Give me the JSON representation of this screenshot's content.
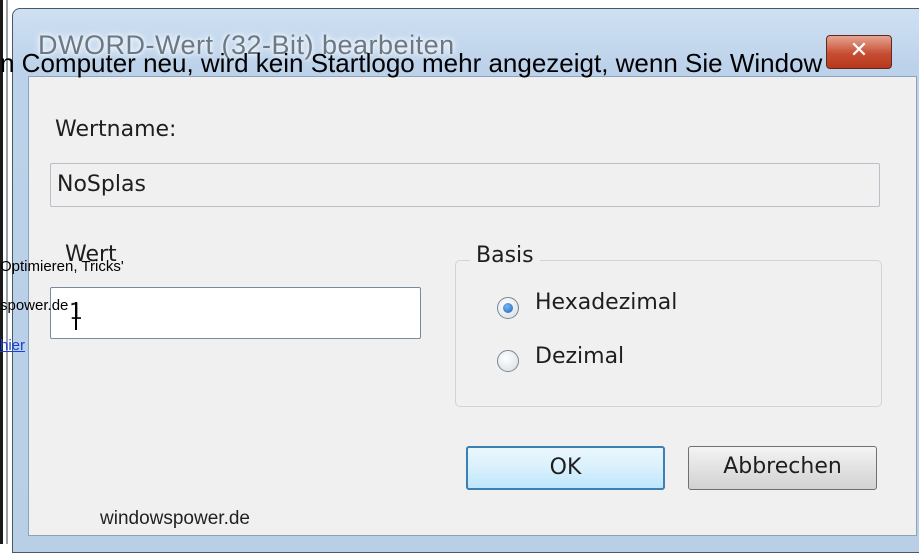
{
  "dialog": {
    "title": "DWORD-Wert (32-Bit) bearbeiten",
    "close_label": "✕",
    "name_label": "Wertname:",
    "name_value": "NoSplas",
    "value_label": "Wert",
    "value_input": "1",
    "base_group_label": "Basis",
    "radio_hex_label": "Hexadezimal",
    "radio_dec_label": "Dezimal",
    "selected_base": "Hexadezimal",
    "ok_label": "OK",
    "cancel_label": "Abbrechen"
  },
  "background_page": {
    "top_text": "n Computer neu, wird kein Startlogo mehr angezeigt, wenn Sie Window",
    "side_text_1": "Optimieren, Tricks'",
    "side_text_2": "spower.de",
    "link_text": "hier",
    "watermark": "windowspower.de"
  },
  "colors": {
    "close_button": "#c64e32",
    "ok_border": "#3c7fb1",
    "link": "#1a3fd6"
  }
}
